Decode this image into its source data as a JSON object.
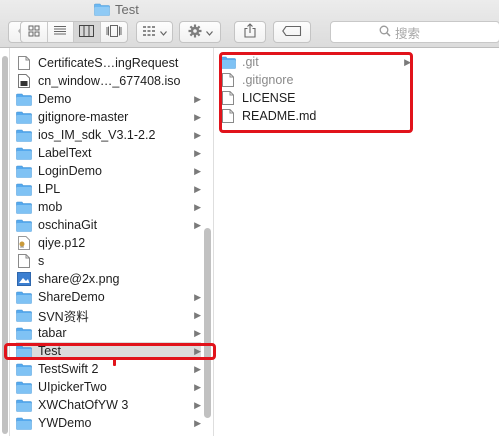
{
  "window": {
    "title": "Test",
    "search_placeholder": "搜索"
  },
  "toolbar": {
    "nav_back_icon": "chevron-left-icon",
    "nav_forward_icon": "chevron-right-icon",
    "view_modes": [
      "icon-view",
      "list-view",
      "column-view",
      "cover-flow-view"
    ],
    "active_view": "column-view",
    "group_icon": "grid-group-icon",
    "action_icon": "gear-icon",
    "share_icon": "share-icon",
    "tag_icon": "tag-icon",
    "search_icon": "search-icon"
  },
  "middle_column": {
    "items": [
      {
        "name": "CertificateS…ingRequest",
        "kind": "file",
        "has_children": false
      },
      {
        "name": "cn_window…_677408.iso",
        "kind": "disk-image",
        "has_children": false
      },
      {
        "name": "Demo",
        "kind": "folder",
        "has_children": true
      },
      {
        "name": "gitignore-master",
        "kind": "folder",
        "has_children": true
      },
      {
        "name": "ios_IM_sdk_V3.1-2.2",
        "kind": "folder",
        "has_children": true
      },
      {
        "name": "LabelText",
        "kind": "folder",
        "has_children": true
      },
      {
        "name": "LoginDemo",
        "kind": "folder",
        "has_children": true
      },
      {
        "name": "LPL",
        "kind": "folder",
        "has_children": true
      },
      {
        "name": "mob",
        "kind": "folder",
        "has_children": true
      },
      {
        "name": "oschinaGit",
        "kind": "folder",
        "has_children": true
      },
      {
        "name": "qiye.p12",
        "kind": "certificate",
        "has_children": false
      },
      {
        "name": "s",
        "kind": "file",
        "has_children": false
      },
      {
        "name": "share@2x.png",
        "kind": "image",
        "has_children": false
      },
      {
        "name": "ShareDemo",
        "kind": "folder",
        "has_children": true
      },
      {
        "name": "SVN资料",
        "kind": "folder",
        "has_children": true
      },
      {
        "name": "tabar",
        "kind": "folder",
        "has_children": true
      },
      {
        "name": "Test",
        "kind": "folder",
        "has_children": true,
        "selected": true
      },
      {
        "name": "TestSwift 2",
        "kind": "folder",
        "has_children": true
      },
      {
        "name": "UIpickerTwo",
        "kind": "folder",
        "has_children": true
      },
      {
        "name": "XWChatOfYW 3",
        "kind": "folder",
        "has_children": true
      },
      {
        "name": "YWDemo",
        "kind": "folder",
        "has_children": true
      }
    ]
  },
  "right_column": {
    "items": [
      {
        "name": ".git",
        "kind": "folder",
        "has_children": true,
        "dim": true
      },
      {
        "name": ".gitignore",
        "kind": "file",
        "has_children": false,
        "dim": true
      },
      {
        "name": "LICENSE",
        "kind": "file",
        "has_children": false,
        "dim": false
      },
      {
        "name": "README.md",
        "kind": "file",
        "has_children": false,
        "dim": false
      }
    ]
  },
  "colors": {
    "folder_blue": "#5aaef0",
    "annotation_red": "#e1131b",
    "selection_gray": "#dcdcdc"
  }
}
